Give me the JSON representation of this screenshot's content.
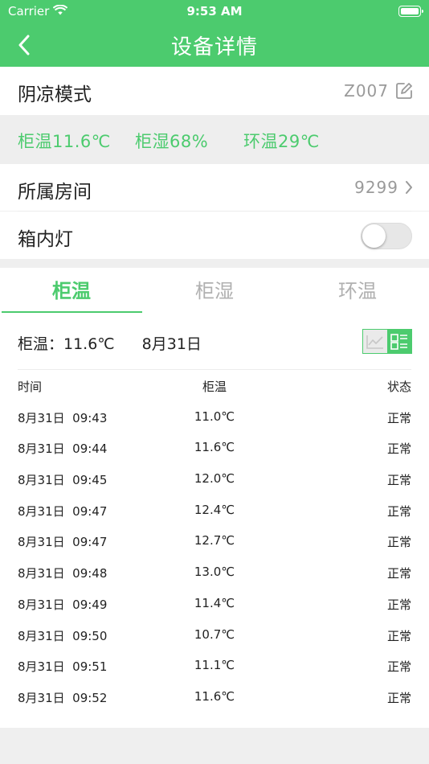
{
  "status_bar": {
    "carrier": "Carrier",
    "time": "9:53 AM"
  },
  "nav": {
    "title": "设备详情"
  },
  "mode_row": {
    "title": "阴凉模式",
    "code": "Z007"
  },
  "stats": {
    "cabinet_temp": "柜温11.6℃",
    "cabinet_humidity": "柜湿68%",
    "ambient_temp": "环温29℃"
  },
  "room_row": {
    "title": "所属房间",
    "value": "9299"
  },
  "light_row": {
    "title": "箱内灯",
    "on": false
  },
  "tabs": [
    {
      "label": "柜温",
      "active": true
    },
    {
      "label": "柜湿",
      "active": false
    },
    {
      "label": "环温",
      "active": false
    }
  ],
  "summary": {
    "label": "柜温：11.6℃",
    "date": "8月31日"
  },
  "table": {
    "headers": [
      "时间",
      "柜温",
      "状态"
    ],
    "rows": [
      [
        "8月31日  09:43",
        "11.0℃",
        "正常"
      ],
      [
        "8月31日  09:44",
        "11.6℃",
        "正常"
      ],
      [
        "8月31日  09:45",
        "12.0℃",
        "正常"
      ],
      [
        "8月31日  09:47",
        "12.4℃",
        "正常"
      ],
      [
        "8月31日  09:47",
        "12.7℃",
        "正常"
      ],
      [
        "8月31日  09:48",
        "13.0℃",
        "正常"
      ],
      [
        "8月31日  09:49",
        "11.4℃",
        "正常"
      ],
      [
        "8月31日  09:50",
        "10.7℃",
        "正常"
      ],
      [
        "8月31日  09:51",
        "11.1℃",
        "正常"
      ],
      [
        "8月31日  09:52",
        "11.6℃",
        "正常"
      ]
    ]
  },
  "colors": {
    "accent": "#4ccb6e",
    "muted": "#9a9a9a",
    "background": "#efefef"
  },
  "icons": {
    "back": "chevron-left-icon",
    "edit": "edit-icon",
    "room_chevron": "chevron-right-icon",
    "chart_view": "line-chart-icon",
    "list_view": "list-icon",
    "wifi": "wifi-icon",
    "battery": "battery-icon"
  }
}
